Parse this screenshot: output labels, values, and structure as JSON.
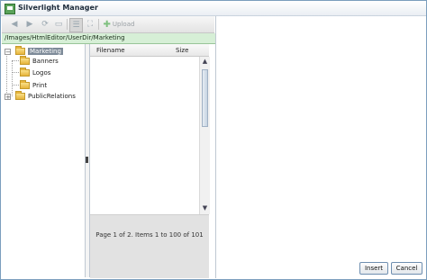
{
  "window": {
    "title": "Silverlight Manager"
  },
  "toolbar": {
    "upload_label": "Upload"
  },
  "path": "/Images/HtmlEditor/UserDir/Marketing",
  "tree": {
    "root": "Marketing",
    "children": [
      "Banners",
      "Logos",
      "Print"
    ],
    "sibling": "PublicRelations"
  },
  "file_list": {
    "columns": [
      "Filename",
      "Size"
    ],
    "pager_text": "Page 1 of 2. Items 1 to 100 of 101"
  },
  "buttons": {
    "insert": "Insert",
    "cancel": "Cancel"
  }
}
